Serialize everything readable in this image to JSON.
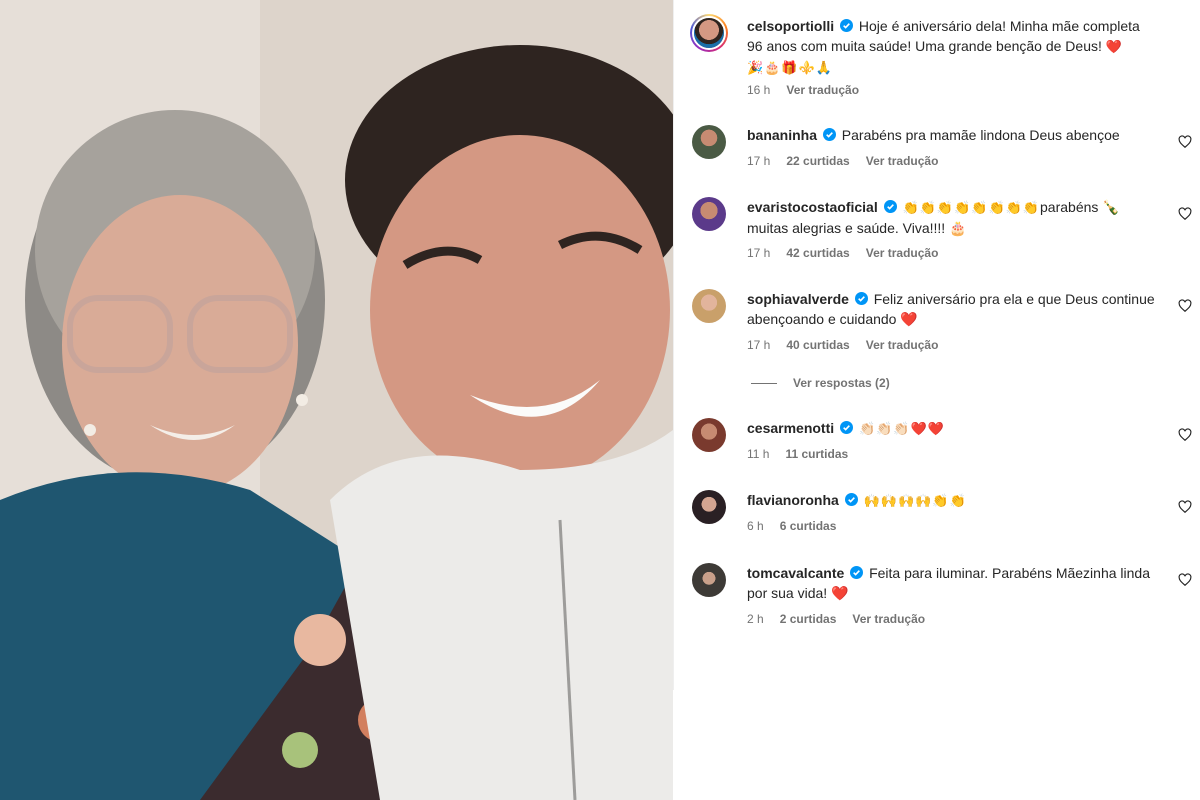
{
  "post": {
    "author": "celsoportiolli",
    "caption": "Hoje é aniversário dela! Minha mãe completa 96 anos com muita saúde! Uma grande benção de Deus!",
    "caption_emojis": "🎉🎂🎁⚜️🙏",
    "time": "16 h",
    "translate_label": "Ver tradução"
  },
  "comments": [
    {
      "user": "bananinha",
      "text": "Parabéns pra mamãe lindona Deus abençoe",
      "time": "17 h",
      "likes": "22 curtidas",
      "translate": "Ver tradução",
      "avatar_color": "#4a5a44"
    },
    {
      "user": "evaristocostaoficial",
      "text": "parabéns 🍾 muitas alegrias e saúde. Viva!!!! 🎂",
      "lead_emojis": "👏👏👏👏👏👏👏👏",
      "time": "17 h",
      "likes": "42 curtidas",
      "translate": "Ver tradução",
      "avatar_color": "#5b3a8a"
    },
    {
      "user": "sophiavalverde",
      "text": "Feliz aniversário pra ela e que Deus continue abençoando e cuidando ❤️",
      "time": "17 h",
      "likes": "40 curtidas",
      "translate": "Ver tradução",
      "avatar_color": "#c9a06a"
    },
    {
      "user": "cesarmenotti",
      "text": "👏🏻👏🏻👏🏻❤️❤️",
      "time": "11 h",
      "likes": "11 curtidas",
      "translate": "",
      "avatar_color": "#7a3a2e"
    },
    {
      "user": "flavianoronha",
      "text": "🙌🙌🙌🙌👏👏",
      "time": "6 h",
      "likes": "6 curtidas",
      "translate": "",
      "avatar_color": "#2a2024"
    },
    {
      "user": "tomcavalcante",
      "text": "Feita para iluminar. Parabéns Mãezinha linda por sua vida! ❤️",
      "time": "2 h",
      "likes": "2 curtidas",
      "translate": "Ver tradução",
      "avatar_color": "#3d3a36"
    }
  ],
  "replies_label": "Ver respostas (2)",
  "colors": {
    "verified": "#0095f6",
    "muted": "#737373",
    "text": "#262626"
  },
  "icons": {
    "like": "heart-outline-icon",
    "verified": "verified-badge-icon"
  }
}
